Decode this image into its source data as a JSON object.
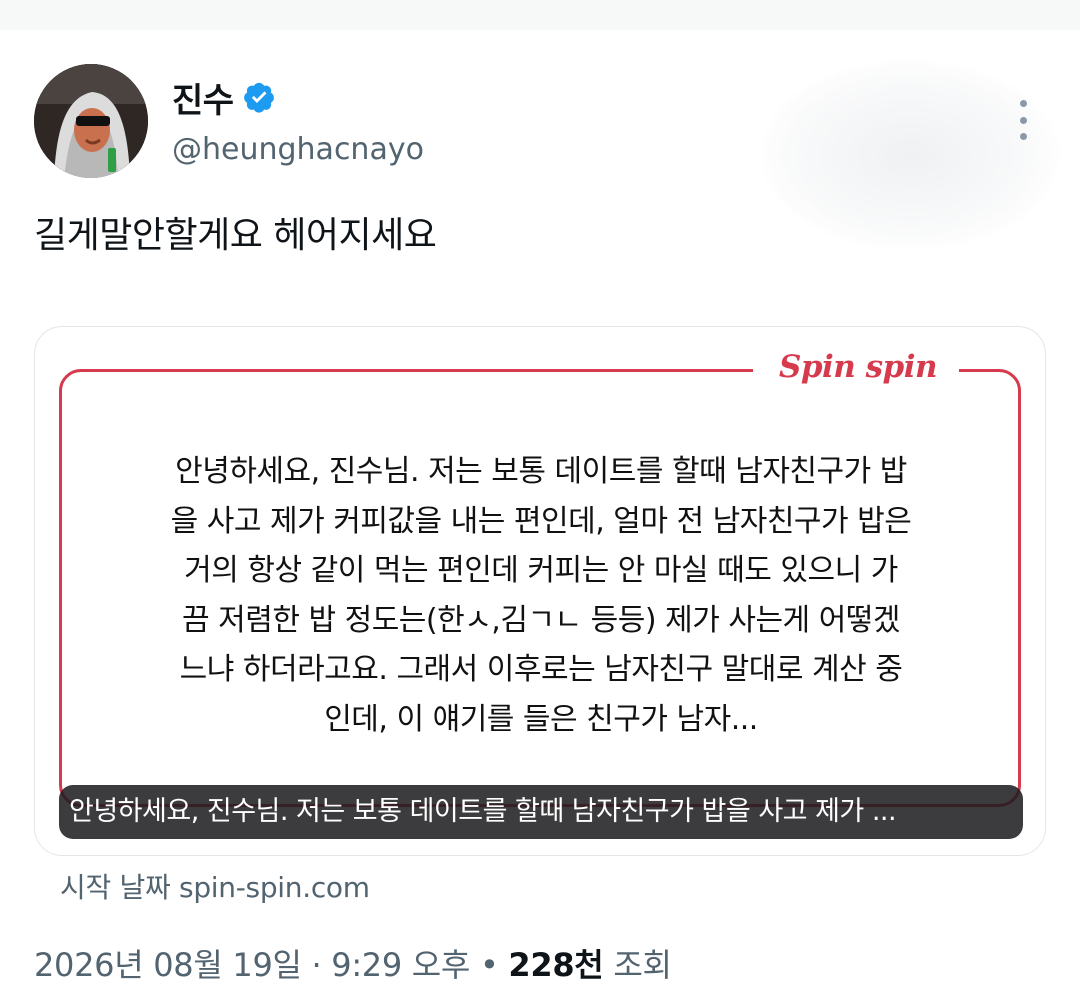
{
  "author": {
    "display_name": "진수",
    "handle": "@heunghacnayo",
    "verified_icon": "verified-badge-icon",
    "verified_color": "#1d9bf0"
  },
  "more_icon": "more-vertical-icon",
  "tweet": {
    "text": "길게말안할게요 헤어지세요"
  },
  "card": {
    "brand": "Spin spin",
    "brand_color": "#d63a4d",
    "body_lines": [
      "안녕하세요, 진수님. 저는 보통 데이트를 할때 남자친구가 밥",
      "을 사고 제가 커피값을 내는 편인데, 얼마 전 남자친구가 밥은",
      "거의 항상 같이 먹는 편인데 커피는 안 마실 때도 있으니 가",
      "끔 저렴한 밥 정도는(한ㅅ,김ㄱㄴ 등등) 제가 사는게 어떻겠",
      "느냐 하더라고요. 그래서 이후로는 남자친구 말대로 계산 중",
      "인데, 이 얘기를 들은 친구가 남자..."
    ],
    "caption": "안녕하세요, 진수님. 저는 보통 데이트를 할때 남자친구가 밥을 사고 제가 ..."
  },
  "source": {
    "text": "시작 날짜 spin-spin.com"
  },
  "meta": {
    "date": "2026년 08월 19일",
    "separator1": " · ",
    "time": "9:29 오후",
    "separator2": " • ",
    "views_count": "228천",
    "views_label": " 조회"
  }
}
